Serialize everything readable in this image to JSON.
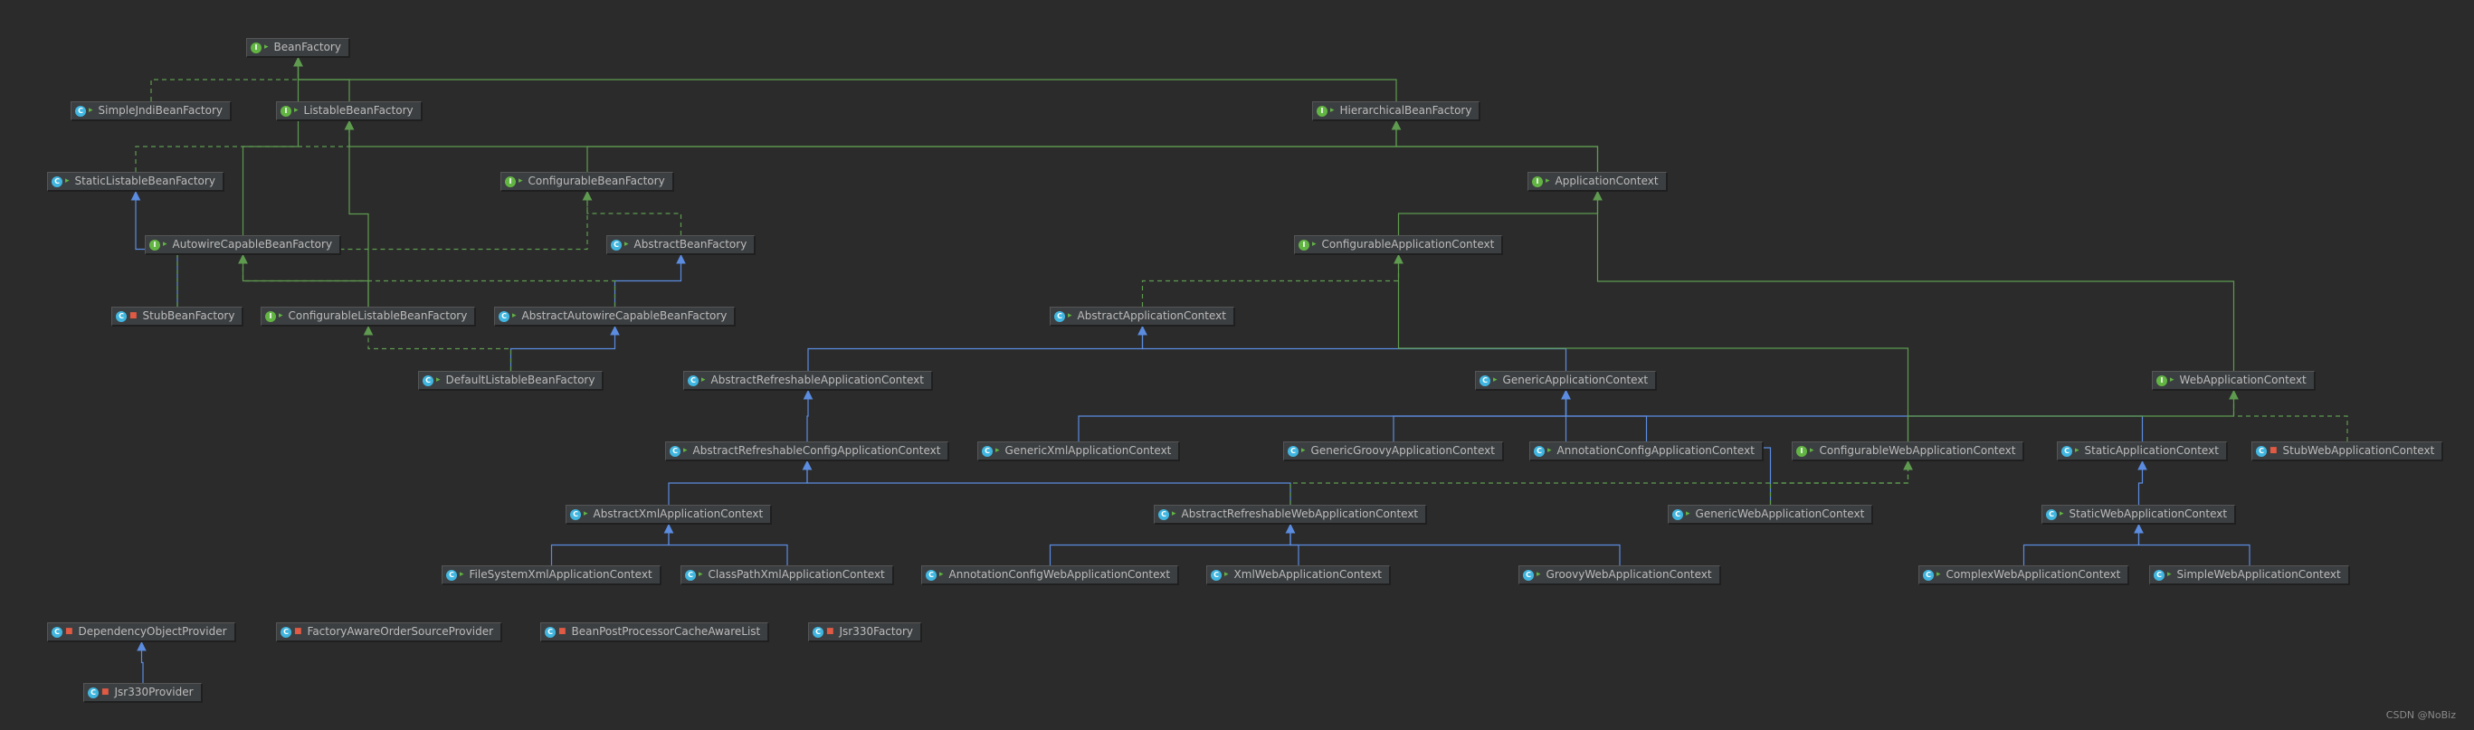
{
  "diagram": {
    "watermark": "CSDN @NoBiz",
    "colors": {
      "background": "#2b2b2b",
      "node_fill": "#3c3f41",
      "extends": "#5b8ce0",
      "implements": "#5e9b4f"
    },
    "nodes": [
      {
        "id": "BeanFactory",
        "label": "BeanFactory",
        "kind": "interface",
        "vis": "public"
      },
      {
        "id": "SimpleJndiBeanFactory",
        "label": "SimpleJndiBeanFactory",
        "kind": "class",
        "vis": "public"
      },
      {
        "id": "ListableBeanFactory",
        "label": "ListableBeanFactory",
        "kind": "interface",
        "vis": "public"
      },
      {
        "id": "HierarchicalBeanFactory",
        "label": "HierarchicalBeanFactory",
        "kind": "interface",
        "vis": "public"
      },
      {
        "id": "StaticListableBeanFactory",
        "label": "StaticListableBeanFactory",
        "kind": "class",
        "vis": "public"
      },
      {
        "id": "ConfigurableBeanFactory",
        "label": "ConfigurableBeanFactory",
        "kind": "interface",
        "vis": "public"
      },
      {
        "id": "ApplicationContext",
        "label": "ApplicationContext",
        "kind": "interface",
        "vis": "public"
      },
      {
        "id": "AutowireCapableBeanFactory",
        "label": "AutowireCapableBeanFactory",
        "kind": "interface",
        "vis": "public"
      },
      {
        "id": "AbstractBeanFactory",
        "label": "AbstractBeanFactory",
        "kind": "class",
        "vis": "public"
      },
      {
        "id": "ConfigurableApplicationContext",
        "label": "ConfigurableApplicationContext",
        "kind": "interface",
        "vis": "public"
      },
      {
        "id": "StubBeanFactory",
        "label": "StubBeanFactory",
        "kind": "class",
        "vis": "private"
      },
      {
        "id": "ConfigurableListableBeanFactory",
        "label": "ConfigurableListableBeanFactory",
        "kind": "interface",
        "vis": "public"
      },
      {
        "id": "AbstractAutowireCapableBeanFactory",
        "label": "AbstractAutowireCapableBeanFactory",
        "kind": "class",
        "vis": "public"
      },
      {
        "id": "AbstractApplicationContext",
        "label": "AbstractApplicationContext",
        "kind": "class",
        "vis": "public"
      },
      {
        "id": "DefaultListableBeanFactory",
        "label": "DefaultListableBeanFactory",
        "kind": "class",
        "vis": "public"
      },
      {
        "id": "AbstractRefreshableApplicationContext",
        "label": "AbstractRefreshableApplicationContext",
        "kind": "class",
        "vis": "public"
      },
      {
        "id": "GenericApplicationContext",
        "label": "GenericApplicationContext",
        "kind": "class",
        "vis": "public"
      },
      {
        "id": "WebApplicationContext",
        "label": "WebApplicationContext",
        "kind": "interface",
        "vis": "public"
      },
      {
        "id": "AbstractRefreshableConfigApplicationContext",
        "label": "AbstractRefreshableConfigApplicationContext",
        "kind": "class",
        "vis": "public"
      },
      {
        "id": "GenericXmlApplicationContext",
        "label": "GenericXmlApplicationContext",
        "kind": "class",
        "vis": "public"
      },
      {
        "id": "GenericGroovyApplicationContext",
        "label": "GenericGroovyApplicationContext",
        "kind": "class",
        "vis": "public"
      },
      {
        "id": "AnnotationConfigApplicationContext",
        "label": "AnnotationConfigApplicationContext",
        "kind": "class",
        "vis": "public"
      },
      {
        "id": "ConfigurableWebApplicationContext",
        "label": "ConfigurableWebApplicationContext",
        "kind": "interface",
        "vis": "public"
      },
      {
        "id": "StaticApplicationContext",
        "label": "StaticApplicationContext",
        "kind": "class",
        "vis": "public"
      },
      {
        "id": "StubWebApplicationContext",
        "label": "StubWebApplicationContext",
        "kind": "class",
        "vis": "private"
      },
      {
        "id": "AbstractXmlApplicationContext",
        "label": "AbstractXmlApplicationContext",
        "kind": "class",
        "vis": "public"
      },
      {
        "id": "AbstractRefreshableWebApplicationContext",
        "label": "AbstractRefreshableWebApplicationContext",
        "kind": "class",
        "vis": "public"
      },
      {
        "id": "GenericWebApplicationContext",
        "label": "GenericWebApplicationContext",
        "kind": "class",
        "vis": "public"
      },
      {
        "id": "StaticWebApplicationContext",
        "label": "StaticWebApplicationContext",
        "kind": "class",
        "vis": "public"
      },
      {
        "id": "FileSystemXmlApplicationContext",
        "label": "FileSystemXmlApplicationContext",
        "kind": "class",
        "vis": "public"
      },
      {
        "id": "ClassPathXmlApplicationContext",
        "label": "ClassPathXmlApplicationContext",
        "kind": "class",
        "vis": "public"
      },
      {
        "id": "AnnotationConfigWebApplicationContext",
        "label": "AnnotationConfigWebApplicationContext",
        "kind": "class",
        "vis": "public"
      },
      {
        "id": "XmlWebApplicationContext",
        "label": "XmlWebApplicationContext",
        "kind": "class",
        "vis": "public"
      },
      {
        "id": "GroovyWebApplicationContext",
        "label": "GroovyWebApplicationContext",
        "kind": "class",
        "vis": "public"
      },
      {
        "id": "ComplexWebApplicationContext",
        "label": "ComplexWebApplicationContext",
        "kind": "class",
        "vis": "public"
      },
      {
        "id": "SimpleWebApplicationContext",
        "label": "SimpleWebApplicationContext",
        "kind": "class",
        "vis": "public"
      },
      {
        "id": "DependencyObjectProvider",
        "label": "DependencyObjectProvider",
        "kind": "class",
        "vis": "private"
      },
      {
        "id": "FactoryAwareOrderSourceProvider",
        "label": "FactoryAwareOrderSourceProvider",
        "kind": "class",
        "vis": "private"
      },
      {
        "id": "BeanPostProcessorCacheAwareList",
        "label": "BeanPostProcessorCacheAwareList",
        "kind": "class",
        "vis": "private"
      },
      {
        "id": "Jsr330Factory",
        "label": "Jsr330Factory",
        "kind": "class",
        "vis": "private"
      },
      {
        "id": "Jsr330Provider",
        "label": "Jsr330Provider",
        "kind": "class",
        "vis": "private"
      }
    ],
    "edges": [
      {
        "from": "SimpleJndiBeanFactory",
        "to": "BeanFactory",
        "type": "implements"
      },
      {
        "from": "ListableBeanFactory",
        "to": "BeanFactory",
        "type": "extends-interface"
      },
      {
        "from": "HierarchicalBeanFactory",
        "to": "BeanFactory",
        "type": "extends-interface"
      },
      {
        "from": "AutowireCapableBeanFactory",
        "to": "BeanFactory",
        "type": "extends-interface"
      },
      {
        "from": "StaticListableBeanFactory",
        "to": "ListableBeanFactory",
        "type": "implements"
      },
      {
        "from": "ConfigurableBeanFactory",
        "to": "HierarchicalBeanFactory",
        "type": "extends-interface"
      },
      {
        "from": "ApplicationContext",
        "to": "ListableBeanFactory",
        "type": "extends-interface"
      },
      {
        "from": "ApplicationContext",
        "to": "HierarchicalBeanFactory",
        "type": "extends-interface"
      },
      {
        "from": "AbstractBeanFactory",
        "to": "ConfigurableBeanFactory",
        "type": "implements"
      },
      {
        "from": "ConfigurableApplicationContext",
        "to": "ApplicationContext",
        "type": "extends-interface"
      },
      {
        "from": "WebApplicationContext",
        "to": "ApplicationContext",
        "type": "extends-interface"
      },
      {
        "from": "StubBeanFactory",
        "to": "StaticListableBeanFactory",
        "type": "extends"
      },
      {
        "from": "StubBeanFactory",
        "to": "ConfigurableBeanFactory",
        "type": "implements"
      },
      {
        "from": "ConfigurableListableBeanFactory",
        "to": "ListableBeanFactory",
        "type": "extends-interface"
      },
      {
        "from": "ConfigurableListableBeanFactory",
        "to": "AutowireCapableBeanFactory",
        "type": "extends-interface"
      },
      {
        "from": "AbstractAutowireCapableBeanFactory",
        "to": "AbstractBeanFactory",
        "type": "extends"
      },
      {
        "from": "AbstractAutowireCapableBeanFactory",
        "to": "AutowireCapableBeanFactory",
        "type": "implements"
      },
      {
        "from": "DefaultListableBeanFactory",
        "to": "AbstractAutowireCapableBeanFactory",
        "type": "extends"
      },
      {
        "from": "DefaultListableBeanFactory",
        "to": "ConfigurableListableBeanFactory",
        "type": "implements"
      },
      {
        "from": "AbstractApplicationContext",
        "to": "ConfigurableApplicationContext",
        "type": "implements"
      },
      {
        "from": "AbstractRefreshableApplicationContext",
        "to": "AbstractApplicationContext",
        "type": "extends"
      },
      {
        "from": "GenericApplicationContext",
        "to": "AbstractApplicationContext",
        "type": "extends"
      },
      {
        "from": "AbstractRefreshableConfigApplicationContext",
        "to": "AbstractRefreshableApplicationContext",
        "type": "extends"
      },
      {
        "from": "GenericXmlApplicationContext",
        "to": "GenericApplicationContext",
        "type": "extends"
      },
      {
        "from": "GenericGroovyApplicationContext",
        "to": "GenericApplicationContext",
        "type": "extends"
      },
      {
        "from": "AnnotationConfigApplicationContext",
        "to": "GenericApplicationContext",
        "type": "extends"
      },
      {
        "from": "StaticApplicationContext",
        "to": "GenericApplicationContext",
        "type": "extends"
      },
      {
        "from": "GenericWebApplicationContext",
        "to": "GenericApplicationContext",
        "type": "extends"
      },
      {
        "from": "ConfigurableWebApplicationContext",
        "to": "WebApplicationContext",
        "type": "extends-interface"
      },
      {
        "from": "ConfigurableWebApplicationContext",
        "to": "ConfigurableApplicationContext",
        "type": "extends-interface"
      },
      {
        "from": "StubWebApplicationContext",
        "to": "WebApplicationContext",
        "type": "implements"
      },
      {
        "from": "AbstractXmlApplicationContext",
        "to": "AbstractRefreshableConfigApplicationContext",
        "type": "extends"
      },
      {
        "from": "AbstractRefreshableWebApplicationContext",
        "to": "AbstractRefreshableConfigApplicationContext",
        "type": "extends"
      },
      {
        "from": "AbstractRefreshableWebApplicationContext",
        "to": "ConfigurableWebApplicationContext",
        "type": "implements"
      },
      {
        "from": "GenericWebApplicationContext",
        "to": "ConfigurableWebApplicationContext",
        "type": "implements"
      },
      {
        "from": "StaticWebApplicationContext",
        "to": "StaticApplicationContext",
        "type": "extends"
      },
      {
        "from": "FileSystemXmlApplicationContext",
        "to": "AbstractXmlApplicationContext",
        "type": "extends"
      },
      {
        "from": "ClassPathXmlApplicationContext",
        "to": "AbstractXmlApplicationContext",
        "type": "extends"
      },
      {
        "from": "AnnotationConfigWebApplicationContext",
        "to": "AbstractRefreshableWebApplicationContext",
        "type": "extends"
      },
      {
        "from": "XmlWebApplicationContext",
        "to": "AbstractRefreshableWebApplicationContext",
        "type": "extends"
      },
      {
        "from": "GroovyWebApplicationContext",
        "to": "AbstractRefreshableWebApplicationContext",
        "type": "extends"
      },
      {
        "from": "ComplexWebApplicationContext",
        "to": "StaticWebApplicationContext",
        "type": "extends"
      },
      {
        "from": "SimpleWebApplicationContext",
        "to": "StaticWebApplicationContext",
        "type": "extends"
      },
      {
        "from": "Jsr330Provider",
        "to": "DependencyObjectProvider",
        "type": "extends"
      }
    ]
  }
}
